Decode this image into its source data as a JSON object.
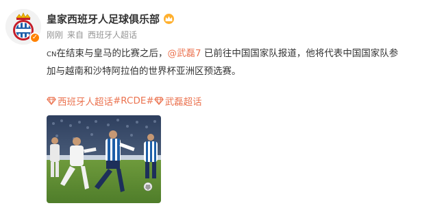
{
  "account": {
    "name": "皇家西班牙人足球俱乐部",
    "avatar_icon": "rcd-espanyol-crest-icon",
    "verified_icon": "verified-badge-icon",
    "badge_icon": "crown-badge-icon"
  },
  "meta": {
    "time": "刚刚",
    "source_prefix": "来自",
    "source": "西班牙人超话"
  },
  "post": {
    "prefix": "CN",
    "text_before": "在结束与皇马的比赛之后，",
    "mention": "@武磊7",
    "text_after": " 已前往中国国家队报道，他将代表中国国家队参加与越南和沙特阿拉伯的世界杯亚洲区预选赛。"
  },
  "tags": {
    "topic1": "西班牙人超话",
    "hashtag": "#RCDE#",
    "topic2": "武磊超话",
    "tag_icon": "super-topic-diamond-icon"
  },
  "photo": {
    "icon": "football-match-photo"
  },
  "colors": {
    "accent": "#eb7350",
    "meta": "#939393",
    "text": "#333333",
    "verified": "#ff8200"
  }
}
